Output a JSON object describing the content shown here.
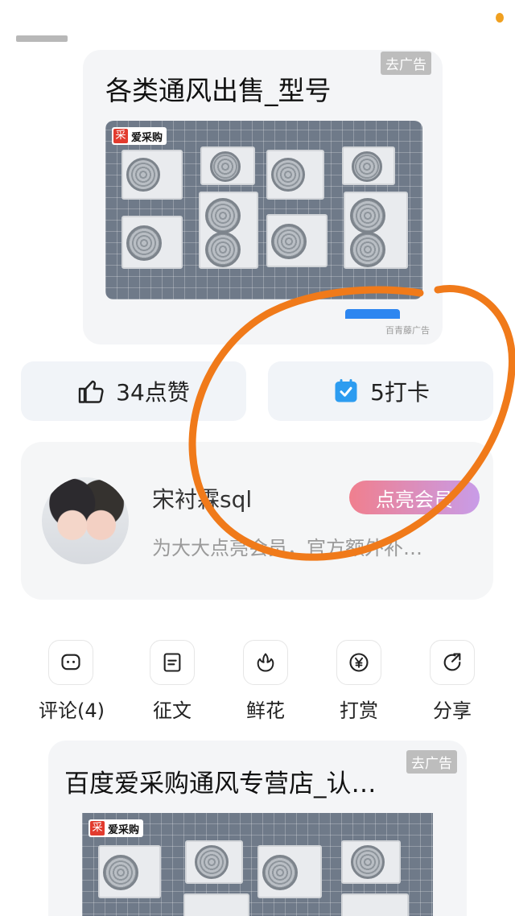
{
  "ad1": {
    "title": "各类通风出售_型号",
    "tag": "去广告",
    "logo_mark": "采",
    "logo_text": "爱采购",
    "source": "百青藤广告"
  },
  "actions_top": {
    "like_label": "34点赞",
    "checkin_label": "5打卡"
  },
  "user": {
    "name": "宋衬霖sql",
    "vip_button": "点亮会员",
    "description": "为大大点亮会员，官方额外补…"
  },
  "actions": [
    {
      "label": "评论(4)",
      "icon": "comment-icon"
    },
    {
      "label": "征文",
      "icon": "essay-icon"
    },
    {
      "label": "鲜花",
      "icon": "flower-icon"
    },
    {
      "label": "打赏",
      "icon": "yuan-icon"
    },
    {
      "label": "分享",
      "icon": "share-icon"
    }
  ],
  "ad2": {
    "title": "百度爱采购通风专营店_认…",
    "tag": "去广告",
    "logo_mark": "采",
    "logo_text": "爱采购"
  },
  "colors": {
    "annotation": "#f07a1a",
    "vip_gradient_start": "#f07f8e",
    "vip_gradient_end": "#c89ce8",
    "checkin_icon": "#2d9cf0"
  }
}
